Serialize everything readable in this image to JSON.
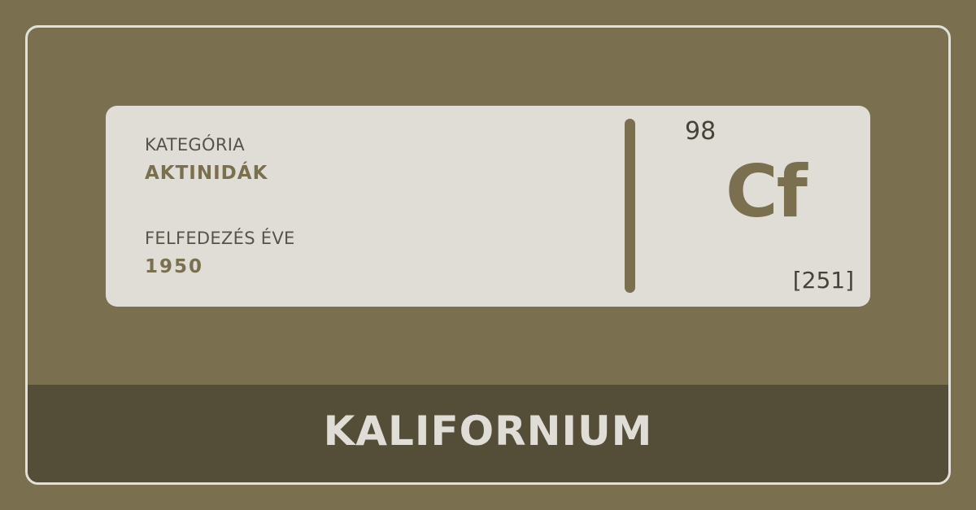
{
  "card": {
    "category_label": "KATEGÓRIA",
    "category_value": "AKTINIDÁK",
    "discovery_label": "FELFEDEZÉS ÉVE",
    "discovery_value": "1950",
    "atomic_number": "98",
    "symbol": "Cf",
    "atomic_mass": "[251]"
  },
  "footer": {
    "element_name": "KALIFORNIUM"
  },
  "colors": {
    "background": "#7a7050",
    "card": "#dfddd6",
    "footer": "#544e38",
    "accent": "#7a7050",
    "text_dark": "#454438"
  }
}
